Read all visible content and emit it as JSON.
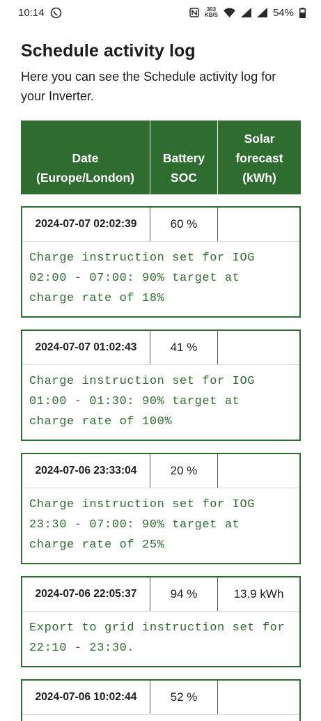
{
  "status_bar": {
    "time": "10:14",
    "speed_top": "303",
    "speed_bottom": "KB/S",
    "battery": "54%"
  },
  "page": {
    "title": "Schedule activity log",
    "description": "Here you can see the Schedule activity log for your Inverter."
  },
  "table": {
    "headers": [
      "Date\n(Europe/London)",
      "Battery\nSOC",
      "Solar\nforecast\n(kWh)"
    ],
    "entries": [
      {
        "date": "2024-07-07 02:02:39",
        "soc": "60 %",
        "solar": "",
        "message": "Charge instruction set for IOG 02:00 - 07:00: 90% target at charge rate of 18%"
      },
      {
        "date": "2024-07-07 01:02:43",
        "soc": "41 %",
        "solar": "",
        "message": "Charge instruction set for IOG 01:00 - 01:30: 90% target at charge rate of 100%"
      },
      {
        "date": "2024-07-06 23:33:04",
        "soc": "20 %",
        "solar": "",
        "message": "Charge instruction set for IOG 23:30 - 07:00: 90% target at charge rate of 25%"
      },
      {
        "date": "2024-07-06 22:05:37",
        "soc": "94 %",
        "solar": "13.9 kWh",
        "message": "Export to grid instruction set for 22:10 - 23:30."
      },
      {
        "date": "2024-07-06 10:02:44",
        "soc": "52 %",
        "solar": "",
        "message": ""
      }
    ]
  },
  "colors": {
    "accent": "#2e6d2f",
    "text": "#1c1c1c",
    "background": "#ffffff"
  }
}
